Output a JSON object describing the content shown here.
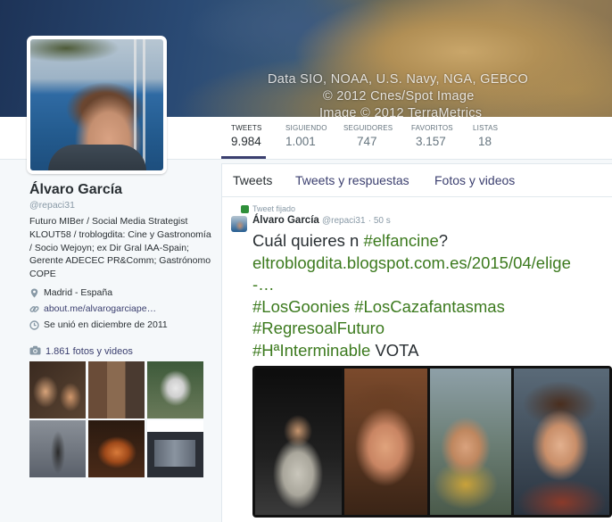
{
  "banner": {
    "credit_lines": [
      "Data SIO, NOAA, U.S. Navy, NGA, GEBCO",
      "© 2012 Cnes/Spot Image",
      "Image © 2012 TerraMetrics"
    ]
  },
  "stats": [
    {
      "label": "TWEETS",
      "value": "9.984"
    },
    {
      "label": "SIGUIENDO",
      "value": "1.001"
    },
    {
      "label": "SEGUIDORES",
      "value": "747"
    },
    {
      "label": "FAVORITOS",
      "value": "3.157"
    },
    {
      "label": "LISTAS",
      "value": "18"
    }
  ],
  "profile": {
    "name": "Álvaro García",
    "handle": "@repaci31",
    "bio": "Futuro MIBer / Social Media Strategist KLOUT58 / troblogdita: Cine y Gastronomía / Socio Wejoyn; ex Dir Gral IAA-Spain; Gerente ADECEC PR&Comm; Gastrónomo COPE",
    "location": "Madrid - España",
    "website": "about.me/alvarogarciape…",
    "joined": "Se unió en diciembre de 2011",
    "photos_link": "1.861 fotos y videos"
  },
  "tabs": [
    "Tweets",
    "Tweets y respuestas",
    "Fotos y videos"
  ],
  "tweet": {
    "pinned_label": "Tweet fijado",
    "author": "Álvaro García",
    "handle": "@repaci31",
    "time": "· 50 s",
    "text_line1_prefix": "Cuál quieres n ",
    "hashtag_elfancine": "#elfancine",
    "text_line1_suffix": "?",
    "link": "eltroblogdita.blogspot.com.es/2015/04/elige",
    "link_cont": "-…",
    "hashtag_goonies": "#LosGoonies",
    "hashtag_cazafantasmas": "#LosCazafantasmas",
    "hashtag_regreso": "#RegresoalFuturo",
    "hashtag_interminable": "#HªInterminable",
    "text_vota": " VOTA"
  },
  "colors": {
    "link": "#3b3f6f",
    "hashtag": "#3c7a1e",
    "text": "#292f33",
    "muted": "#8899a6"
  }
}
